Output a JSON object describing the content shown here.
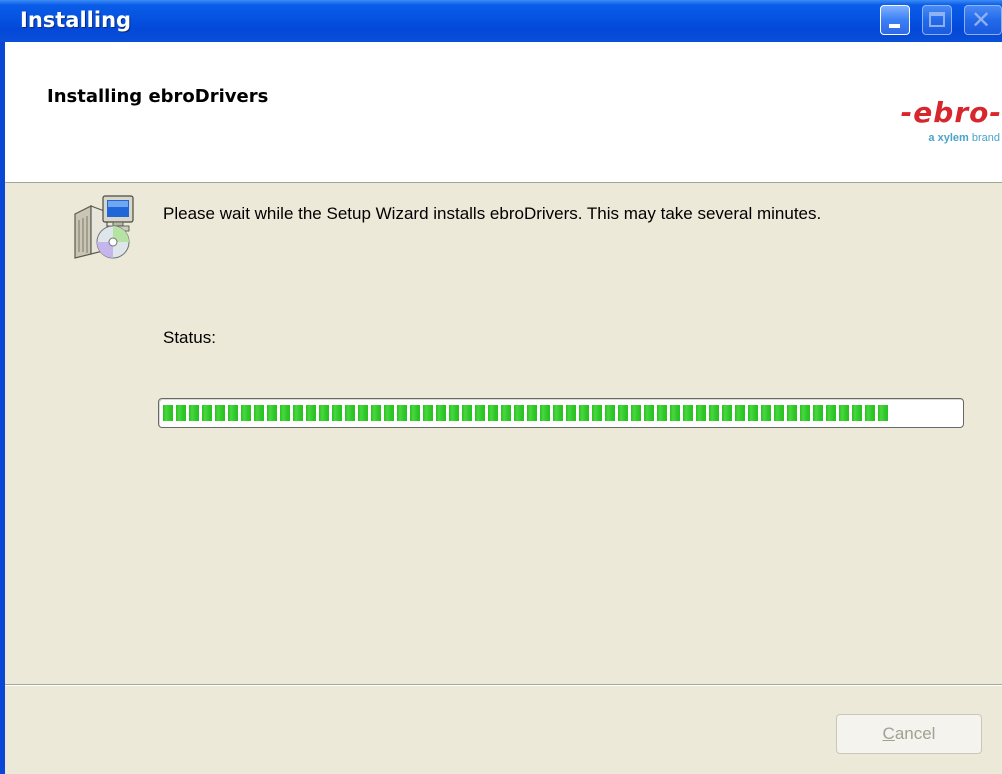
{
  "window": {
    "title": "Installing"
  },
  "header": {
    "title": "Installing ebroDrivers",
    "logo_main": "-ebro-",
    "logo_sub_bold": "a xylem",
    "logo_sub_rest": " brand"
  },
  "body": {
    "message": "Please wait while the Setup Wizard installs ebroDrivers. This may take several minutes.",
    "status_label": "Status:",
    "progress_fraction": 0.92
  },
  "footer": {
    "cancel_label_first": "C",
    "cancel_label_rest": "ancel"
  },
  "colors": {
    "titlebar": "#0654e2",
    "logo_red": "#d8262d",
    "progress_green": "#28c020",
    "dialog_bg": "#ece9d8"
  },
  "icons": {
    "installer": "setup-computer-disc-icon",
    "minimize": "minimize-icon",
    "maximize": "maximize-icon",
    "close": "close-icon"
  }
}
